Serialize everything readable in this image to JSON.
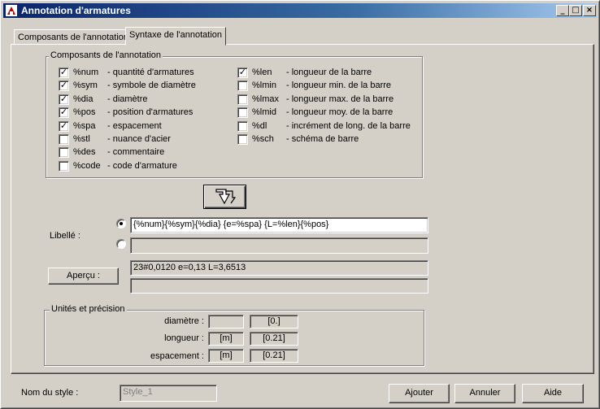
{
  "window": {
    "title": "Annotation d'armatures"
  },
  "tabs": [
    {
      "label": "Composants de l'annotation"
    },
    {
      "label": "Syntaxe de l'annotation"
    }
  ],
  "components_group": {
    "title": "Composants de l'annotation",
    "left_items": [
      {
        "code": "%num",
        "desc": "- quantité d'armatures",
        "checked": true
      },
      {
        "code": "%sym",
        "desc": "- symbole de diamètre",
        "checked": true
      },
      {
        "code": "%dia",
        "desc": "- diamètre",
        "checked": true
      },
      {
        "code": "%pos",
        "desc": "- position d'armatures",
        "checked": true
      },
      {
        "code": "%spa",
        "desc": "- espacement",
        "checked": true
      },
      {
        "code": "%stl",
        "desc": "- nuance d'acier",
        "checked": false
      },
      {
        "code": "%des",
        "desc": "- commentaire",
        "checked": false
      },
      {
        "code": "%code",
        "desc": "- code d'armature",
        "checked": false
      }
    ],
    "right_items": [
      {
        "code": "%len",
        "desc": "- longueur de la barre",
        "checked": true
      },
      {
        "code": "%lmin",
        "desc": "- longueur min. de la barre",
        "checked": false
      },
      {
        "code": "%lmax",
        "desc": "- longueur max. de la barre",
        "checked": false
      },
      {
        "code": "%lmid",
        "desc": "- longueur moy. de la barre",
        "checked": false
      },
      {
        "code": "%dl",
        "desc": "- incrément de long. de la barre",
        "checked": false
      },
      {
        "code": "%sch",
        "desc": "- schéma de barre",
        "checked": false
      }
    ]
  },
  "insert_button": {
    "icon": "insert-arrow-icon"
  },
  "libelle": {
    "label": "Libellé :",
    "line1_value": "{%num}{%sym}{%dia} {e=%spa} {L=%len}{%pos}",
    "line2_value": "",
    "selected": 1
  },
  "apercu": {
    "button_label": "Aperçu :",
    "line1_value": "23#0,0120 e=0,13 L=3,6513",
    "line2_value": ""
  },
  "units_group": {
    "title": "Unités et précision",
    "rows": [
      {
        "label": "diamètre :",
        "unit": "",
        "precision": "[0.]"
      },
      {
        "label": "longueur :",
        "unit": "[m]",
        "precision": "[0.21]"
      },
      {
        "label": "espacement :",
        "unit": "[m]",
        "precision": "[0.21]"
      }
    ]
  },
  "footer": {
    "style_label": "Nom du style :",
    "style_value": "Style_1",
    "add_label": "Ajouter",
    "cancel_label": "Annuler",
    "help_label": "Aide"
  },
  "titlebar_buttons": {
    "minimize": "_",
    "maximize": "□",
    "close": "×"
  }
}
